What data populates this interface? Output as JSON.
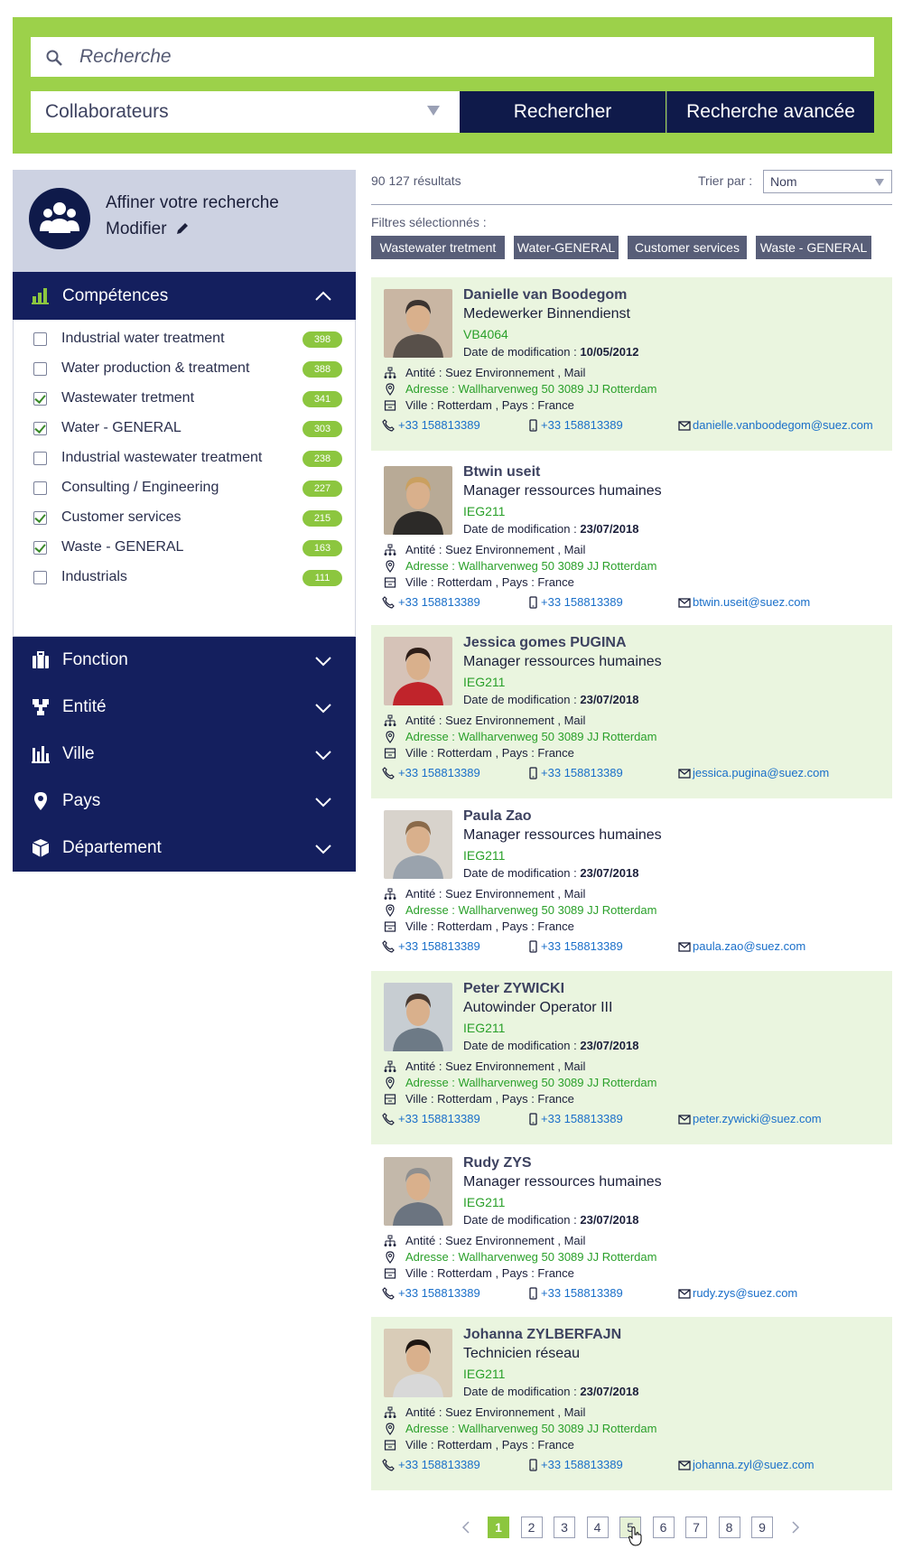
{
  "search": {
    "placeholder": "Recherche",
    "type_value": "Collaborateurs",
    "search_button": "Rechercher",
    "advanced_button": "Recherche avancée"
  },
  "sidebar": {
    "refine_title": "Affiner votre recherche",
    "modify_label": "Modifier",
    "competences": {
      "label": "Compétences",
      "items": [
        {
          "label": "Industrial water treatment",
          "count": "398",
          "checked": false
        },
        {
          "label": "Water production & treatment",
          "count": "388",
          "checked": false
        },
        {
          "label": "Wastewater tretment",
          "count": "341",
          "checked": true
        },
        {
          "label": "Water - GENERAL",
          "count": "303",
          "checked": true
        },
        {
          "label": "Industrial wastewater treatment",
          "count": "238",
          "checked": false
        },
        {
          "label": "Consulting / Engineering",
          "count": "227",
          "checked": false
        },
        {
          "label": "Customer services",
          "count": "215",
          "checked": true
        },
        {
          "label": "Waste - GENERAL",
          "count": "163",
          "checked": true
        },
        {
          "label": "Industrials",
          "count": "111",
          "checked": false
        }
      ]
    },
    "sections": [
      {
        "label": "Fonction",
        "icon": "briefcase-icon"
      },
      {
        "label": "Entité",
        "icon": "hierarchy-icon"
      },
      {
        "label": "Ville",
        "icon": "city-icon"
      },
      {
        "label": "Pays",
        "icon": "location-pin-icon"
      },
      {
        "label": "Département",
        "icon": "cube-icon"
      }
    ]
  },
  "results": {
    "count": "90 127 résultats",
    "sort_label": "Trier par :",
    "sort_value": "Nom",
    "filters_label": "Filtres sélectionnés :",
    "filters": [
      "Wastewater tretment",
      "Water-GENERAL",
      "Customer services",
      "Waste - GENERAL"
    ]
  },
  "people": [
    {
      "name": "Danielle van Boodegom",
      "role": "Medewerker Binnendienst",
      "code": "VB4064",
      "date_label": "Date de modification : ",
      "date": "10/05/2012",
      "entity": "Antité : Suez Environnement , Mail",
      "address": "Adresse : Wallharvenweg 50 3089  JJ Rotterdam",
      "city": "Ville : Rotterdam , Pays : France",
      "phone": "+33 158813389",
      "mobile": "+33 158813389",
      "email": "danielle.vanboodegom@suez.com",
      "highlight": true
    },
    {
      "name": "Btwin useit",
      "role": "Manager ressources humaines",
      "code": "IEG211",
      "date_label": "Date de modification : ",
      "date": "23/07/2018",
      "entity": "Antité : Suez Environnement , Mail",
      "address": "Adresse : Wallharvenweg 50 3089  JJ Rotterdam",
      "city": "Ville : Rotterdam , Pays : France",
      "phone": "+33 158813389",
      "mobile": "+33 158813389",
      "email": "btwin.useit@suez.com",
      "highlight": false
    },
    {
      "name": "Jessica gomes PUGINA",
      "role": "Manager ressources humaines",
      "code": "IEG211",
      "date_label": "Date de modification : ",
      "date": "23/07/2018",
      "entity": "Antité : Suez Environnement , Mail",
      "address": "Adresse : Wallharvenweg 50 3089  JJ Rotterdam",
      "city": "Ville : Rotterdam , Pays : France",
      "phone": "+33 158813389",
      "mobile": "+33 158813389",
      "email": "jessica.pugina@suez.com",
      "highlight": true
    },
    {
      "name": "Paula Zao",
      "role": "Manager ressources humaines",
      "code": "IEG211",
      "date_label": "Date de modification : ",
      "date": "23/07/2018",
      "entity": "Antité : Suez Environnement , Mail",
      "address": "Adresse : Wallharvenweg 50 3089  JJ Rotterdam",
      "city": "Ville : Rotterdam , Pays : France",
      "phone": "+33 158813389",
      "mobile": "+33 158813389",
      "email": "paula.zao@suez.com",
      "highlight": false
    },
    {
      "name": "Peter ZYWICKI",
      "role": "Autowinder Operator III",
      "code": "IEG211",
      "date_label": "Date de modification : ",
      "date": "23/07/2018",
      "entity": "Antité : Suez Environnement , Mail",
      "address": "Adresse : Wallharvenweg 50 3089  JJ Rotterdam",
      "city": "Ville : Rotterdam , Pays : France",
      "phone": "+33 158813389",
      "mobile": "+33 158813389",
      "email": "peter.zywicki@suez.com",
      "highlight": true
    },
    {
      "name": "Rudy ZYS",
      "role": "Manager ressources humaines",
      "code": "IEG211",
      "date_label": "Date de modification : ",
      "date": "23/07/2018",
      "entity": "Antité : Suez Environnement , Mail",
      "address": "Adresse : Wallharvenweg 50 3089  JJ Rotterdam",
      "city": "Ville : Rotterdam , Pays : France",
      "phone": "+33 158813389",
      "mobile": "+33 158813389",
      "email": "rudy.zys@suez.com",
      "highlight": false
    },
    {
      "name": "Johanna ZYLBERFAJN",
      "role": "Technicien réseau",
      "code": "IEG211",
      "date_label": "Date de modification : ",
      "date": "23/07/2018",
      "entity": "Antité : Suez Environnement , Mail",
      "address": "Adresse : Wallharvenweg 50 3089  JJ Rotterdam",
      "city": "Ville : Rotterdam , Pays : France",
      "phone": "+33 158813389",
      "mobile": "+33 158813389",
      "email": "johanna.zyl@suez.com",
      "highlight": true
    }
  ],
  "pagination": {
    "pages": [
      "1",
      "2",
      "3",
      "4",
      "5",
      "6",
      "7",
      "8",
      "9"
    ],
    "current": "1",
    "hovered": "5"
  },
  "colors": {
    "brand_green": "#9cd14a",
    "navy": "#141f5e",
    "count_badge": "#8cc63f",
    "card_highlight": "#eaf5df",
    "link_blue": "#1a6fc9",
    "address_green": "#2aa02a"
  }
}
